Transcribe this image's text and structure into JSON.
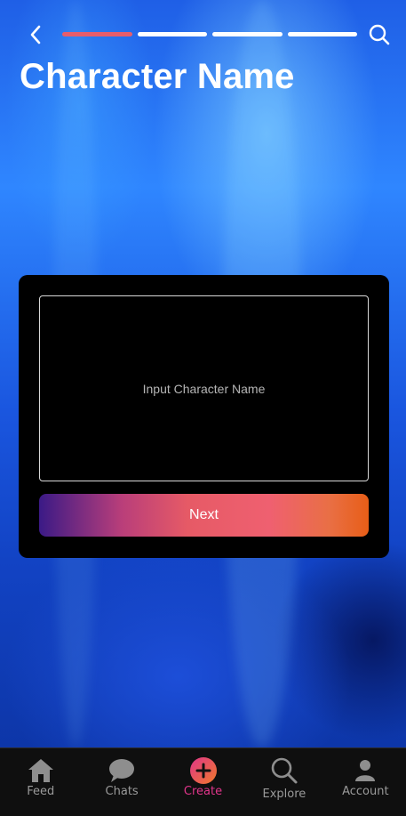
{
  "header": {
    "title": "Character Name",
    "progress": {
      "total_steps": 4,
      "current_step": 1
    }
  },
  "form": {
    "name_placeholder": "Input Character Name",
    "name_value": "",
    "next_label": "Next"
  },
  "tabbar": {
    "items": [
      {
        "label": "Feed",
        "icon": "home-icon"
      },
      {
        "label": "Chats",
        "icon": "chat-bubble-icon"
      },
      {
        "label": "Create",
        "icon": "plus-circle-icon",
        "active": true
      },
      {
        "label": "Explore",
        "icon": "search-icon"
      },
      {
        "label": "Account",
        "icon": "person-icon"
      }
    ]
  },
  "colors": {
    "accent": "#e0358a",
    "progress_active": "#e75d6c",
    "button_gradient": [
      "#3b1a86",
      "#e65a66",
      "#e85e17"
    ]
  }
}
